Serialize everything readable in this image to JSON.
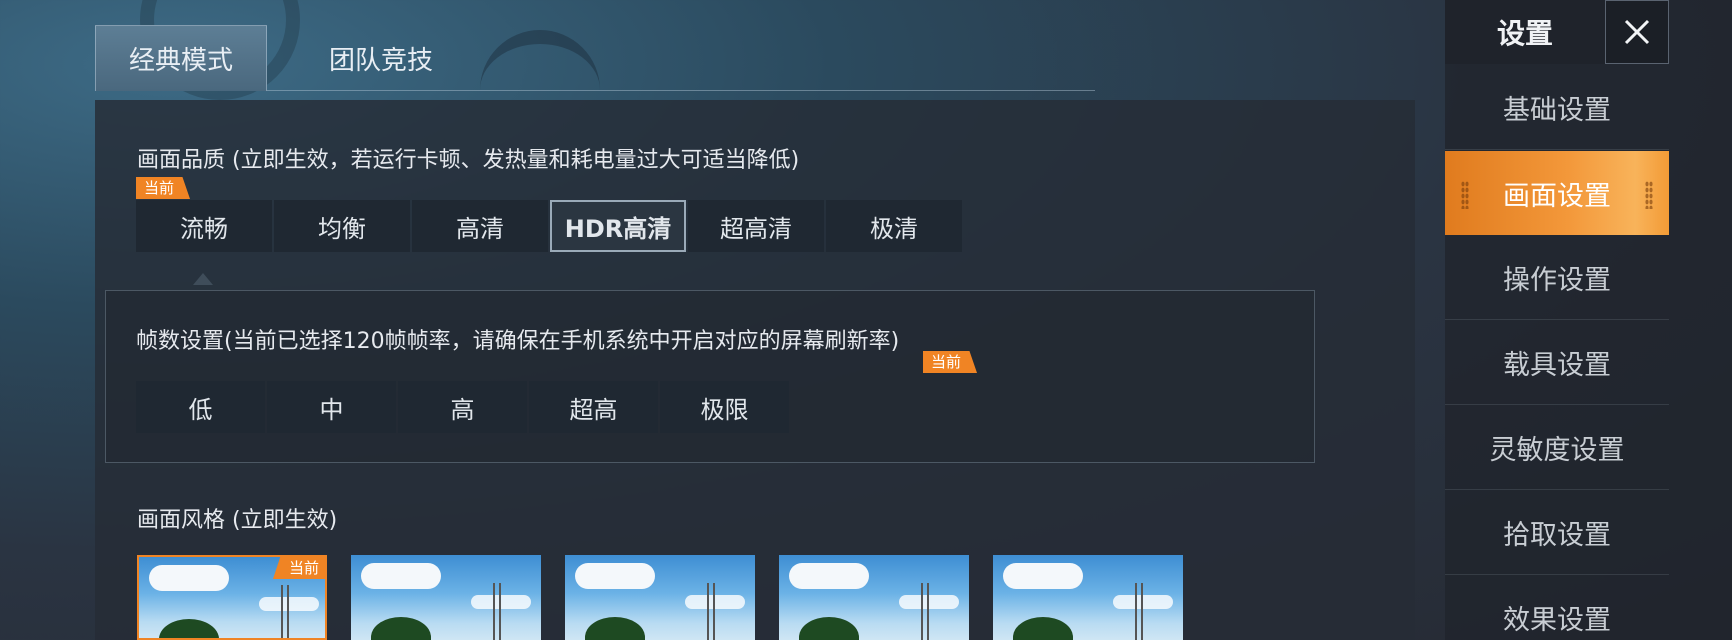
{
  "tabs": [
    {
      "label": "经典模式",
      "active": true
    },
    {
      "label": "团队竞技",
      "active": false
    }
  ],
  "quality": {
    "title": "画面品质 (立即生效，若运行卡顿、发热量和耗电量过大可适当降低)",
    "current_badge": "当前",
    "options": [
      "流畅",
      "均衡",
      "高清",
      "HDR高清",
      "超高清",
      "极清"
    ],
    "selected": "HDR高清",
    "current": "流畅"
  },
  "framerate": {
    "title": "帧数设置(当前已选择120帧帧率，请确保在手机系统中开启对应的屏幕刷新率)",
    "current_badge": "当前",
    "options": [
      "低",
      "中",
      "高",
      "超高",
      "极限"
    ]
  },
  "style": {
    "title": "画面风格 (立即生效)",
    "current_badge": "当前",
    "thumbnail_count": 5,
    "current_index": 0
  },
  "sidebar": {
    "header": "设置",
    "items": [
      {
        "label": "基础设置",
        "active": false
      },
      {
        "label": "画面设置",
        "active": true
      },
      {
        "label": "操作设置",
        "active": false
      },
      {
        "label": "载具设置",
        "active": false
      },
      {
        "label": "灵敏度设置",
        "active": false
      },
      {
        "label": "拾取设置",
        "active": false
      },
      {
        "label": "效果设置",
        "active": false
      }
    ]
  },
  "colors": {
    "accent": "#f08424",
    "panel": "#262c36",
    "segment": "#1f2832"
  }
}
